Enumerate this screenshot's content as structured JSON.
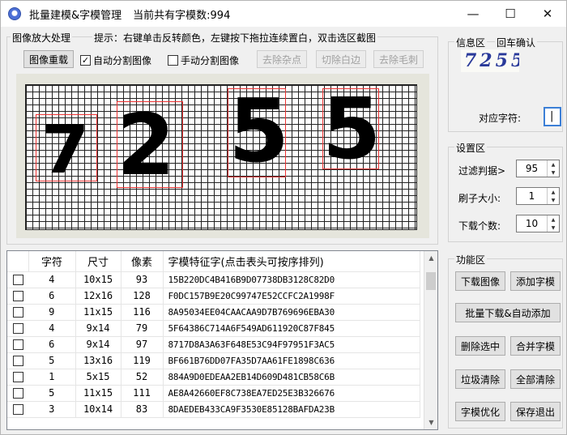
{
  "titlebar": {
    "title": "批量建模&字模管理",
    "subtitle": "当前共有字模数:994",
    "minimize_glyph": "—",
    "maximize_glyph": "☐",
    "close_glyph": "✕"
  },
  "image_panel": {
    "label": "图像放大处理",
    "hint": "提示：右键单击反转颜色，左键按下拖拉连续置白，双击选区截图",
    "reset_button": "图像重载",
    "auto_split_label": "自动分割图像",
    "auto_split_checked": true,
    "manual_split_label": "手动分割图像",
    "manual_split_checked": false,
    "denoise_button": "去除杂点",
    "trim_button": "切除白边",
    "deburr_button": "去除毛刺",
    "glyphs": [
      "7",
      "2",
      "5",
      "5"
    ]
  },
  "info_panel": {
    "label": "信息区",
    "enter_confirm_label": "回车确认",
    "captcha_text": "7255",
    "char_label": "对应字符:",
    "char_value": "|"
  },
  "settings": {
    "label": "设置区",
    "filter_label": "过滤判据>",
    "filter_value": "95",
    "brush_label": "刷子大小:",
    "brush_value": "1",
    "download_label": "下载个数:",
    "download_value": "10"
  },
  "functions": {
    "label": "功能区",
    "download_image": "下载图像",
    "add_glyph": "添加字模",
    "batch_download": "批量下载&自动添加",
    "delete_selected": "删除选中",
    "merge_glyph": "合并字模",
    "junk_clear": "垃圾清除",
    "clear_all": "全部清除",
    "optimize": "字模优化",
    "save_exit": "保存退出"
  },
  "table": {
    "headers": [
      "",
      "字符",
      "尺寸",
      "像素",
      "字模特征字(点击表头可按序排列)"
    ],
    "rows": [
      {
        "char": "4",
        "size": "10x15",
        "pixels": "93",
        "feature": "15B220DC4B416B9D07738DB3128C82D0"
      },
      {
        "char": "6",
        "size": "12x16",
        "pixels": "128",
        "feature": "F0DC157B9E20C99747E52CCFC2A1998F"
      },
      {
        "char": "9",
        "size": "11x15",
        "pixels": "116",
        "feature": "8A95034EE04CAACAA9D7B769696EBA30"
      },
      {
        "char": "4",
        "size": "9x14",
        "pixels": "79",
        "feature": "5F64386C714A6F549AD611920C87F845"
      },
      {
        "char": "6",
        "size": "9x14",
        "pixels": "97",
        "feature": "8717D8A3A63F648E53C94F97951F3AC5"
      },
      {
        "char": "5",
        "size": "13x16",
        "pixels": "119",
        "feature": "BF661B76DD07FA35D7AA61FE1898C636"
      },
      {
        "char": "1",
        "size": "5x15",
        "pixels": "52",
        "feature": "884A9D0EDEAA2EB14D609D481CB58C6B"
      },
      {
        "char": "5",
        "size": "11x15",
        "pixels": "111",
        "feature": "AE8A42660EF8C738EA7ED25E3B326676"
      },
      {
        "char": "3",
        "size": "10x14",
        "pixels": "83",
        "feature": "8DAEDEB433CA9F3530E85128BAFDA23B"
      }
    ]
  }
}
